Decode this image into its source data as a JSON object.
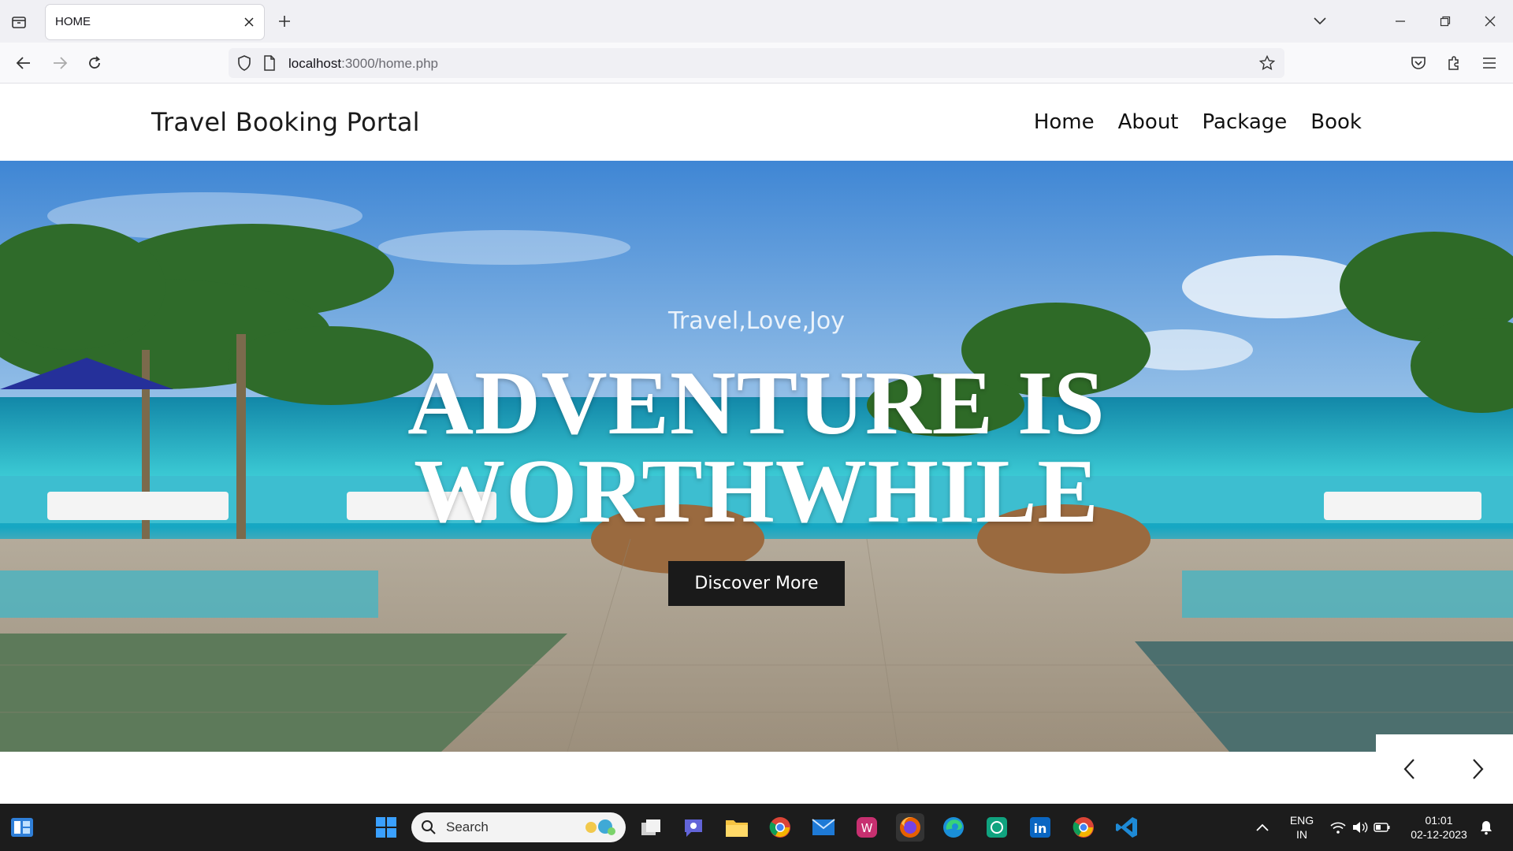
{
  "browser": {
    "tab_title": "HOME",
    "url_host": "localhost",
    "url_path": ":3000/home.php"
  },
  "site": {
    "brand": "Travel Booking Portal",
    "menu": [
      {
        "label": "Home"
      },
      {
        "label": "About"
      },
      {
        "label": "Package"
      },
      {
        "label": "Book"
      }
    ],
    "hero": {
      "tagline": "Travel,Love,Joy",
      "headline_line1": "ADVENTURE IS",
      "headline_line2": "WORTHWHILE",
      "cta_label": "Discover More"
    }
  },
  "taskbar": {
    "search_placeholder": "Search",
    "lang_line1": "ENG",
    "lang_line2": "IN",
    "time": "01:01",
    "date": "02-12-2023",
    "apps": [
      "windows-start",
      "file-explorer-task-view",
      "teams-chat",
      "file-explorer",
      "chrome",
      "mail",
      "wps-office",
      "firefox",
      "edge",
      "chatgpt",
      "linkedin",
      "chrome-profile",
      "vscode"
    ]
  },
  "colors": {
    "cta_bg": "#1a1a1a",
    "taskbar_bg": "#1c1c1c",
    "chrome_bg": "#f0f0f4"
  }
}
